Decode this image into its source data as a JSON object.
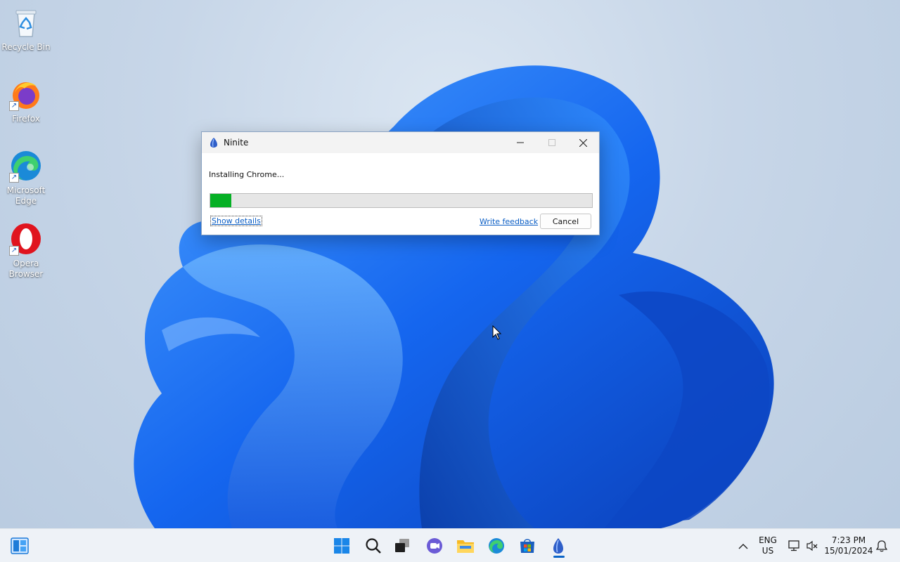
{
  "desktop": {
    "icons": [
      {
        "label": "Recycle Bin",
        "icon": "recycle-bin-icon"
      },
      {
        "label": "Firefox",
        "icon": "firefox-icon"
      },
      {
        "label": "Microsoft Edge",
        "icon": "edge-icon"
      },
      {
        "label": "Opera Browser",
        "icon": "opera-icon"
      }
    ]
  },
  "dialog": {
    "title": "Ninite",
    "status": "Installing Chrome...",
    "progress_percent": 5.5,
    "show_details_label": "Show details",
    "feedback_label": "Write feedback",
    "cancel_label": "Cancel",
    "progress_color": "#06b025"
  },
  "taskbar": {
    "apps": [
      "widgets-icon",
      "start-icon",
      "search-icon",
      "task-view-icon",
      "chat-icon",
      "file-explorer-icon",
      "edge-icon",
      "store-icon",
      "ninite-icon"
    ],
    "tray": {
      "lang_top": "ENG",
      "lang_bottom": "US",
      "time": "7:23 PM",
      "date": "15/01/2024"
    }
  },
  "colors": {
    "accent": "#0a64c7",
    "wallpaper_blue": "#1a5fe0"
  }
}
